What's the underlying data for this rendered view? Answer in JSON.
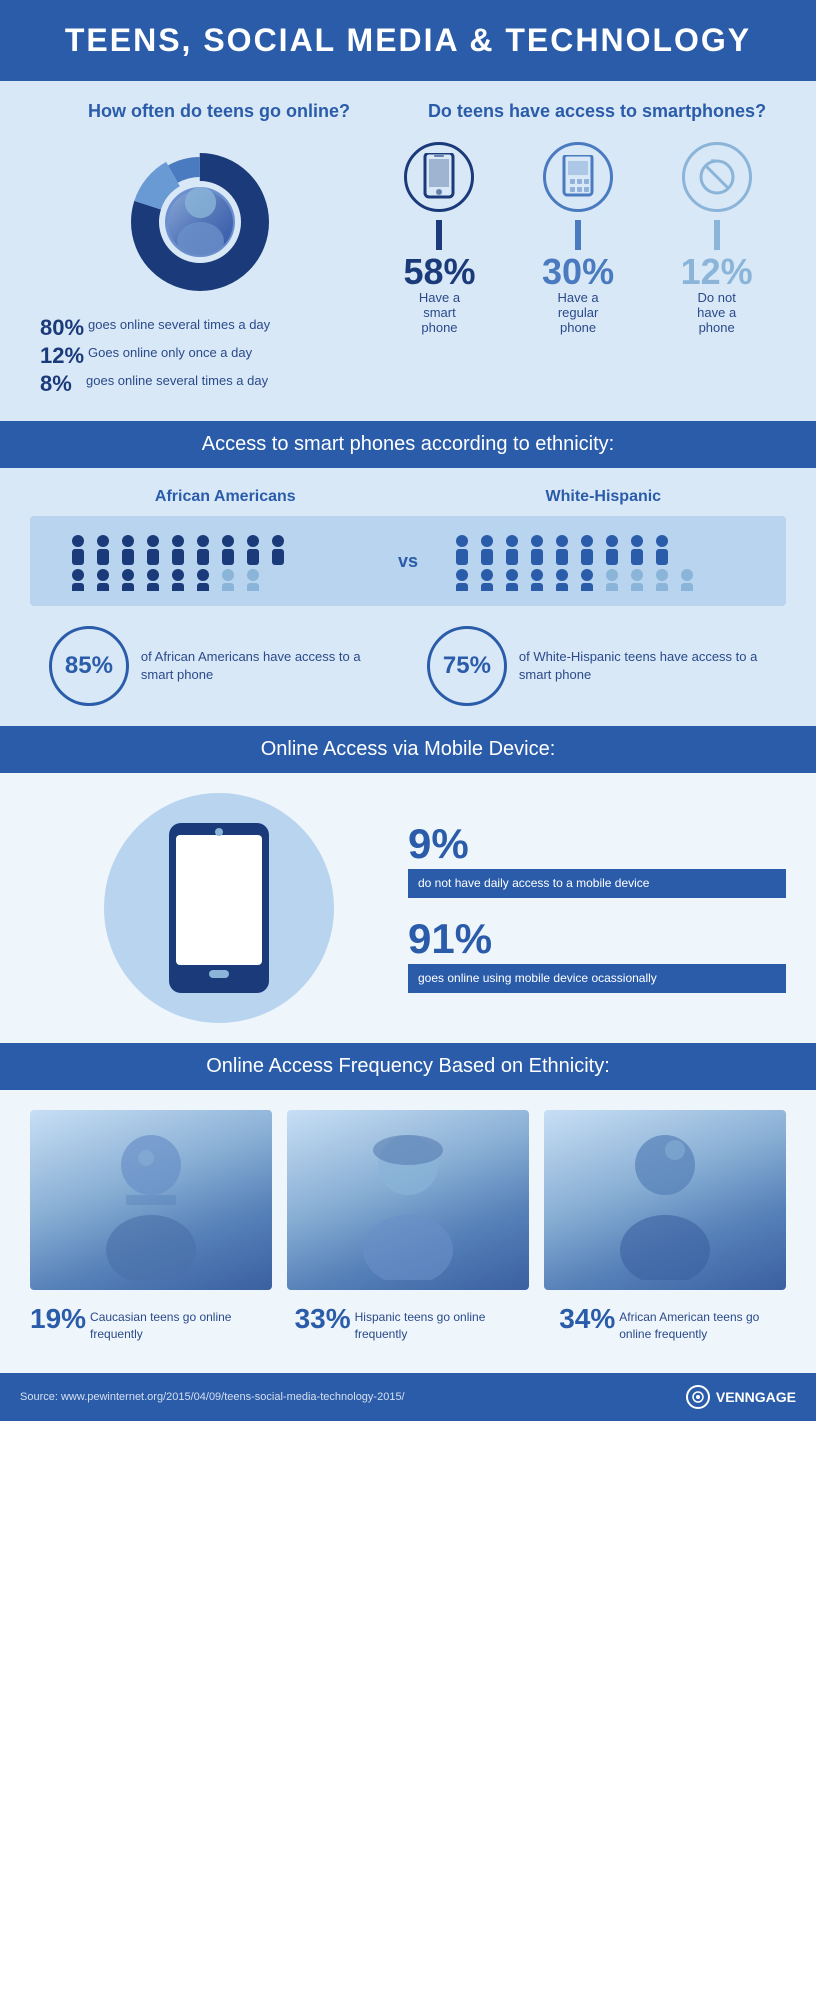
{
  "header": {
    "title": "TEENS, SOCIAL MEDIA & TECHNOLOGY"
  },
  "section1": {
    "left_heading": "How often do teens go online?",
    "right_heading": "Do teens have access to smartphones?",
    "donut": {
      "segments": [
        {
          "pct": 80,
          "color": "#1a3a7a"
        },
        {
          "pct": 12,
          "color": "#6a9ad4"
        },
        {
          "pct": 8,
          "color": "#4a7abf"
        }
      ]
    },
    "frequency_stats": [
      {
        "pct": "80%",
        "desc": "goes online several times a day"
      },
      {
        "pct": "12%",
        "desc": "Goes online only once a day"
      },
      {
        "pct": "8%",
        "desc": "goes online several times a day"
      }
    ],
    "phone_stats": [
      {
        "pct": "58%",
        "label": "Have a smart phone",
        "style": "dark"
      },
      {
        "pct": "30%",
        "label": "Have a regular phone",
        "style": "mid"
      },
      {
        "pct": "12%",
        "label": "Do not have a phone",
        "style": "light"
      }
    ]
  },
  "section2": {
    "band_label": "Access to smart phones according to ethnicity:",
    "left_group": "African Americans",
    "right_group": "White-Hispanic",
    "vs_label": "vs",
    "left_stat_pct": "85%",
    "left_stat_text": "of African Americans have access to a smart phone",
    "right_stat_pct": "75%",
    "right_stat_text": "of White-Hispanic teens have access to a smart phone"
  },
  "section3": {
    "band_label": "Online Access via Mobile Device:",
    "stat1_pct": "9%",
    "stat1_text": "do not have daily access to a mobile device",
    "stat2_pct": "91%",
    "stat2_text": "goes online using mobile device ocassionally"
  },
  "section4": {
    "band_label": "Online Access Frequency Based on Ethnicity:",
    "teens": [
      {
        "pct": "19%",
        "label": "Caucasian teens go online frequently"
      },
      {
        "pct": "33%",
        "label": "Hispanic teens go online frequently"
      },
      {
        "pct": "34%",
        "label": "African American teens go online frequently"
      }
    ]
  },
  "footer": {
    "source": "Source: www.pewinternet.org/2015/04/09/teens-social-media-technology-2015/",
    "brand": "VENNGAGE"
  }
}
